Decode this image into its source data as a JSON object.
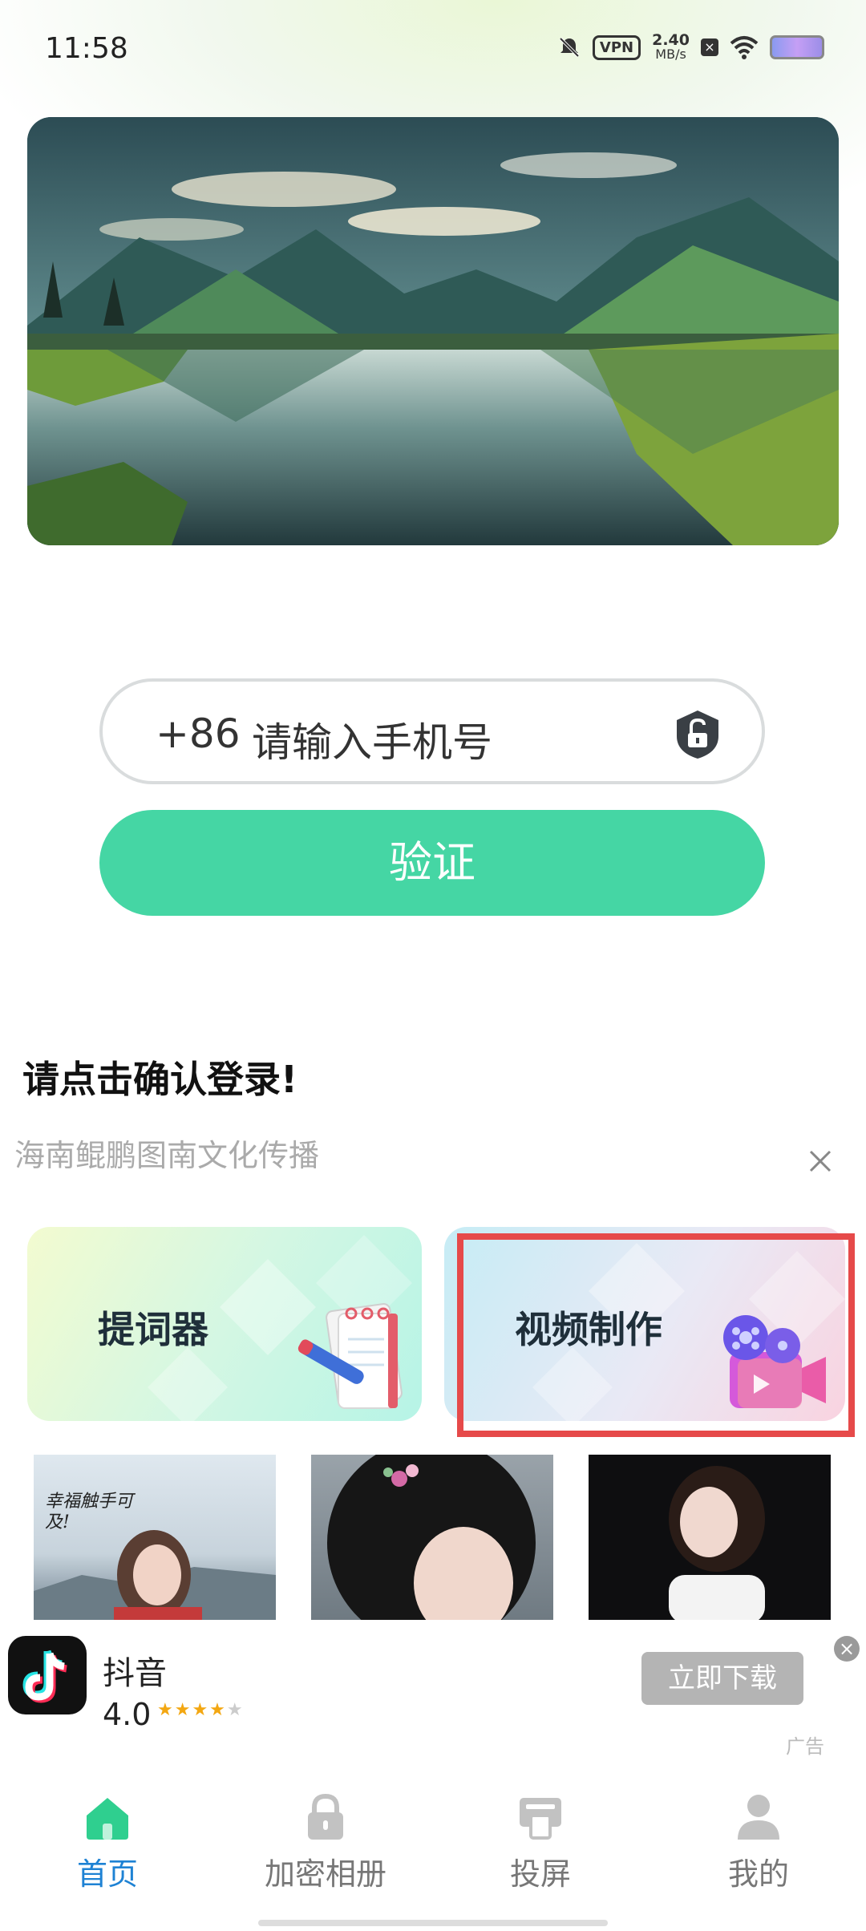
{
  "status_bar": {
    "time": "11:58",
    "vpn": "VPN",
    "speed_value": "2.40",
    "speed_unit": "MB/s"
  },
  "login": {
    "country_code": "+86",
    "phone_placeholder": "请输入手机号",
    "verify_label": "验证",
    "prompt_text": "请点击确认登录!",
    "company_name": "海南鲲鹏图南文化传播"
  },
  "features": [
    {
      "label": "提词器",
      "icon": "notepad-pen-icon"
    },
    {
      "label": "视频制作",
      "icon": "film-camera-icon"
    }
  ],
  "thumbnails": [
    {
      "caption": "幸福触手可及!"
    },
    {
      "caption": ""
    },
    {
      "caption": ""
    }
  ],
  "ad": {
    "app_name": "抖音",
    "rating": "4.0",
    "stars": "★★★★",
    "stars_dim": "★",
    "download_label": "立即下载",
    "ad_tag": "广告"
  },
  "nav": [
    {
      "label": "首页",
      "icon": "home-icon",
      "active": true
    },
    {
      "label": "加密相册",
      "icon": "lock-icon",
      "active": false
    },
    {
      "label": "投屏",
      "icon": "cast-icon",
      "active": false
    },
    {
      "label": "我的",
      "icon": "user-icon",
      "active": false
    }
  ],
  "colors": {
    "accent_green": "#45d6a4",
    "nav_active_blue": "#1e82d4",
    "highlight_red": "#e64a4a"
  }
}
